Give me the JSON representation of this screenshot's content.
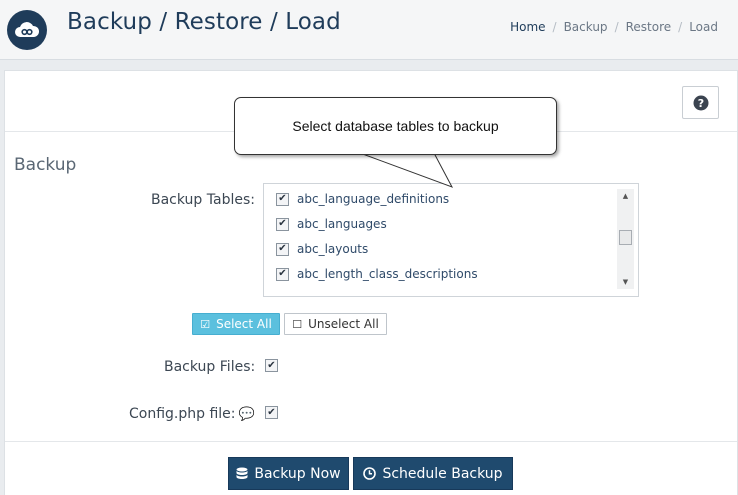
{
  "header": {
    "title": "Backup / Restore / Load",
    "breadcrumb": [
      "Home",
      "Backup",
      "Restore",
      "Load"
    ]
  },
  "help_icon": "question-circle-icon",
  "section": {
    "title": "Backup"
  },
  "backup_tables": {
    "label": "Backup Tables:",
    "items": [
      {
        "name": "abc_language_definitions",
        "checked": true
      },
      {
        "name": "abc_languages",
        "checked": true
      },
      {
        "name": "abc_layouts",
        "checked": true
      },
      {
        "name": "abc_length_class_descriptions",
        "checked": true
      }
    ]
  },
  "buttons": {
    "select_all": "Select All",
    "unselect_all": "Unselect All",
    "backup_now": "Backup Now",
    "schedule_backup": "Schedule Backup"
  },
  "backup_files": {
    "label": "Backup Files:",
    "checked": true
  },
  "config_file": {
    "label": "Config.php file:",
    "checked": true
  },
  "tooltip": {
    "text": "Select database tables to backup"
  },
  "colors": {
    "brand": "#1f3c5a",
    "info": "#5bc0de",
    "primary": "#1f4a6e",
    "comment_icon": "#e8a21a"
  }
}
